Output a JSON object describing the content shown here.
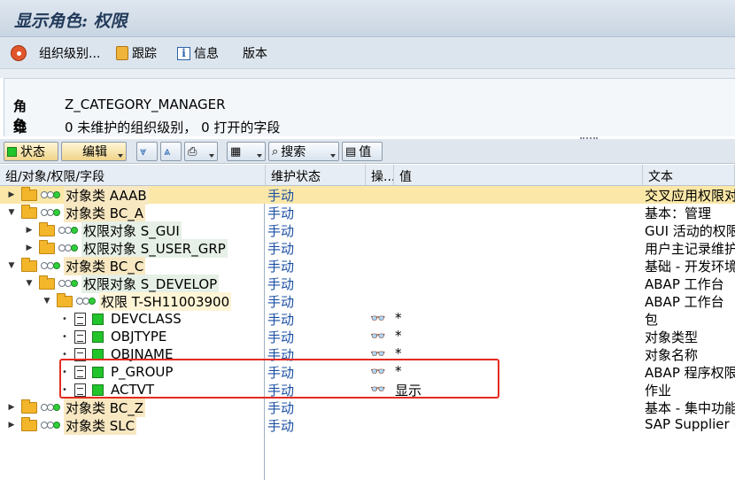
{
  "window": {
    "title": "显示角色: 权限"
  },
  "app_toolbar": {
    "org_levels": "组织级别...",
    "trace": "跟踪",
    "info": "信息",
    "version": "版本"
  },
  "header": {
    "role_label": "角色",
    "role_value": "Z_CATEGORY_MANAGER",
    "maint_label": "维护",
    "maint_value": "0 未维护的组织级别， 0 打开的字段"
  },
  "toolbar": {
    "status": "状态",
    "edit": "编辑",
    "search": "搜索",
    "values": "值"
  },
  "columns": {
    "tree": "组/对象/权限/字段",
    "status": "维护状态",
    "op": "操...",
    "value": "值",
    "text": "文本"
  },
  "rows": [
    {
      "label": "对象类 AAAB",
      "status": "手动",
      "op": "",
      "value": "",
      "text": "交叉应用权限对"
    },
    {
      "label": "对象类 BC_A",
      "status": "手动",
      "op": "",
      "value": "",
      "text": "基本：管理"
    },
    {
      "label": "权限对象 S_GUI",
      "status": "手动",
      "op": "",
      "value": "",
      "text": "GUI 活动的权限"
    },
    {
      "label": "权限对象 S_USER_GRP",
      "status": "手动",
      "op": "",
      "value": "",
      "text": "用户主记录维护"
    },
    {
      "label": "对象类 BC_C",
      "status": "手动",
      "op": "",
      "value": "",
      "text": "基础 - 开发环境"
    },
    {
      "label": "权限对象 S_DEVELOP",
      "status": "手动",
      "op": "",
      "value": "",
      "text": "ABAP 工作台"
    },
    {
      "label": "权限 T-SH11003900",
      "status": "手动",
      "op": "",
      "value": "",
      "text": "ABAP 工作台"
    },
    {
      "label": "DEVCLASS",
      "status": "手动",
      "op": "glasses",
      "value": "*",
      "text": "包"
    },
    {
      "label": "OBJTYPE",
      "status": "手动",
      "op": "glasses",
      "value": "*",
      "text": "对象类型"
    },
    {
      "label": "OBJNAME",
      "status": "手动",
      "op": "glasses",
      "value": "*",
      "text": "对象名称"
    },
    {
      "label": "P_GROUP",
      "status": "手动",
      "op": "glasses",
      "value": "*",
      "text": "ABAP 程序权限"
    },
    {
      "label": "ACTVT",
      "status": "手动",
      "op": "glasses",
      "value": "显示",
      "text": "作业"
    },
    {
      "label": "对象类 BC_Z",
      "status": "手动",
      "op": "",
      "value": "",
      "text": "基本 - 集中功能"
    },
    {
      "label": "对象类 SLC",
      "status": "手动",
      "op": "",
      "value": "",
      "text": "SAP Supplier Li"
    }
  ],
  "colors": {
    "selected_row": "#fbe8a8",
    "status_text": "#1b4fa3",
    "highlight_box": "#e32b22"
  }
}
